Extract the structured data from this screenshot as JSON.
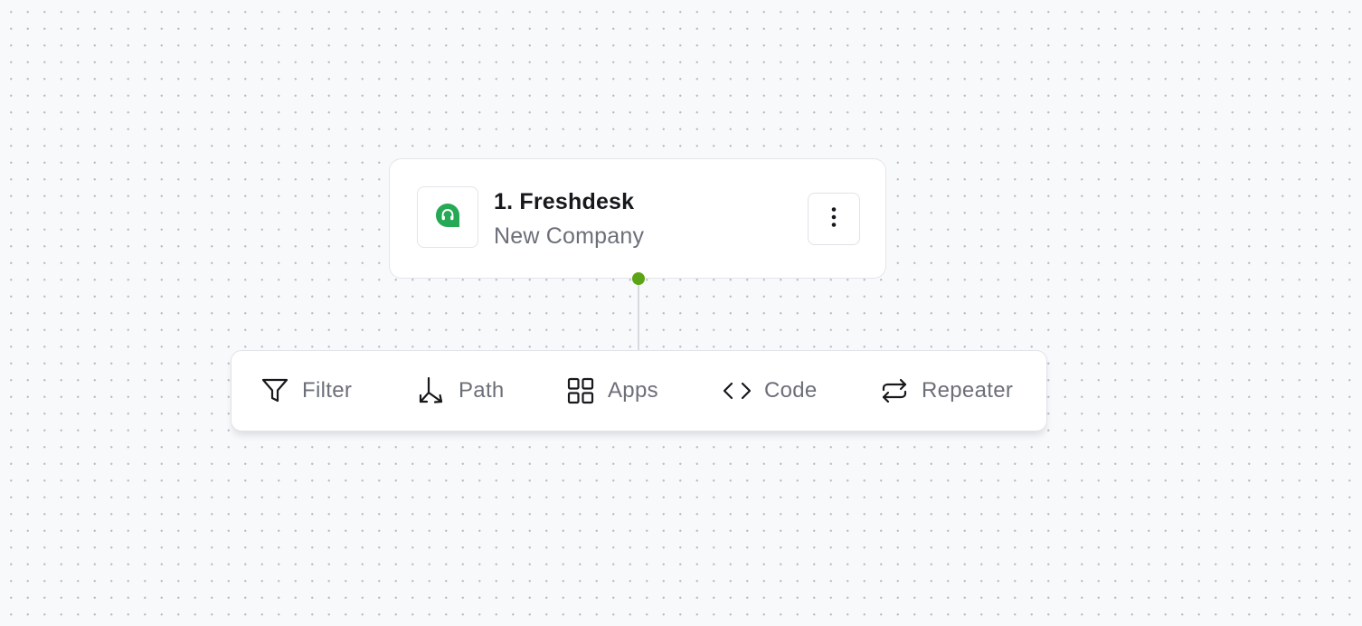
{
  "step": {
    "title": "1. Freshdesk",
    "subtitle": "New Company",
    "app_icon": "freshdesk-headset-icon",
    "menu_icon": "more-vertical-icon",
    "app_color": "#25a955"
  },
  "connector": {
    "status_color": "#5aa416"
  },
  "toolbar": {
    "filter_label": "Filter",
    "filter_icon": "filter-funnel-icon",
    "path_label": "Path",
    "path_icon": "path-split-icon",
    "apps_label": "Apps",
    "apps_icon": "apps-grid-icon",
    "code_label": "Code",
    "code_icon": "code-brackets-icon",
    "repeater_label": "Repeater",
    "repeater_icon": "repeat-arrows-icon"
  }
}
